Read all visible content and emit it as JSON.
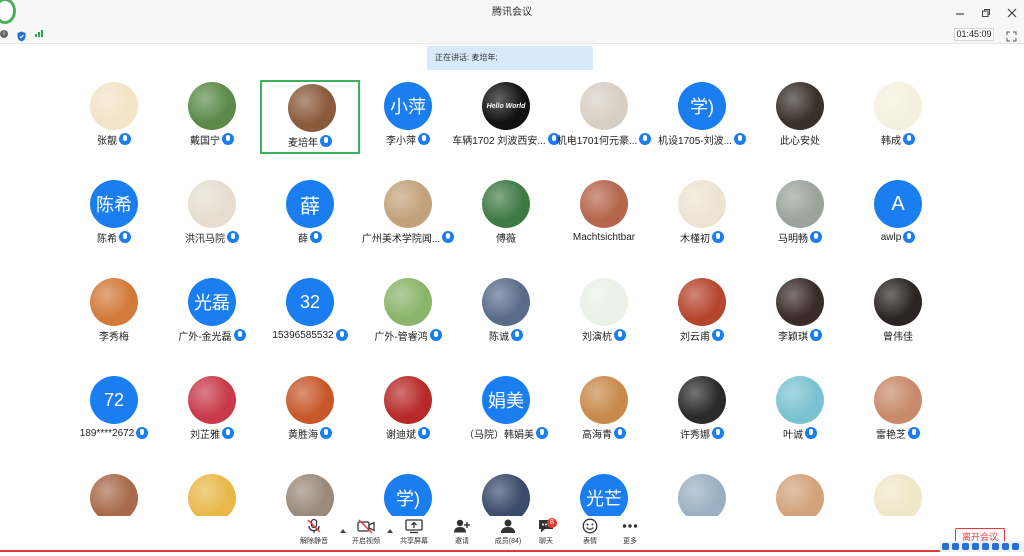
{
  "window": {
    "title": "腾讯会议"
  },
  "toolbar": {
    "timer": "01:45:09"
  },
  "speaker": {
    "banner": "正在讲话: 麦培年;"
  },
  "participants": [
    {
      "name": "张靓",
      "avatar": {
        "kind": "image",
        "label": "cartoon-girl",
        "bg": "#f3e3c8"
      },
      "mic": "on"
    },
    {
      "name": "戴国宁",
      "avatar": {
        "kind": "image",
        "label": "park-photo",
        "bg": "#5c8a4a"
      },
      "mic": "on",
      "host": true
    },
    {
      "name": "麦培年",
      "avatar": {
        "kind": "image",
        "label": "calligraphy",
        "bg": "#8a5a3a"
      },
      "mic": "speaking",
      "selected": true
    },
    {
      "name": "李小萍",
      "avatar": {
        "kind": "text",
        "text": "小萍"
      },
      "mic": "on"
    },
    {
      "name": "车辆1702 刘波西安...",
      "avatar": {
        "kind": "image",
        "label": "Hello World",
        "bg": "#111111"
      },
      "mic": "on"
    },
    {
      "name": "机电1701何元豪...",
      "avatar": {
        "kind": "image",
        "label": "cat-photo",
        "bg": "#d8cfc4"
      },
      "mic": "on"
    },
    {
      "name": "机设1705-刘波...",
      "avatar": {
        "kind": "text",
        "text": "学)"
      },
      "mic": "on"
    },
    {
      "name": "此心安处",
      "avatar": {
        "kind": "image",
        "label": "piano-photo",
        "bg": "#3a302a"
      },
      "mic": "none"
    },
    {
      "name": "韩成",
      "avatar": {
        "kind": "image",
        "label": "sunflower",
        "bg": "#f4f0dd"
      },
      "mic": "on"
    },
    {
      "name": "陈希",
      "avatar": {
        "kind": "text",
        "text": "陈希"
      },
      "mic": "on"
    },
    {
      "name": "洪汛马院",
      "avatar": {
        "kind": "image",
        "label": "drawing",
        "bg": "#e6ddd0"
      },
      "mic": "on"
    },
    {
      "name": "薛",
      "avatar": {
        "kind": "text",
        "text": "薛"
      },
      "mic": "on"
    },
    {
      "name": "广州美术学院闻...",
      "avatar": {
        "kind": "image",
        "label": "anime",
        "bg": "#c2a27a"
      },
      "mic": "on"
    },
    {
      "name": "傅薇",
      "avatar": {
        "kind": "image",
        "label": "leaves",
        "bg": "#3f7a45"
      },
      "mic": "none"
    },
    {
      "name": "Machtsichtbar",
      "avatar": {
        "kind": "image",
        "label": "friends-photo",
        "bg": "#b5654a"
      },
      "mic": "none"
    },
    {
      "name": "木槿初",
      "avatar": {
        "kind": "image",
        "label": "anime-girl",
        "bg": "#ede3d2"
      },
      "mic": "on"
    },
    {
      "name": "马明畅",
      "avatar": {
        "kind": "image",
        "label": "mountain",
        "bg": "#9aa49c"
      },
      "mic": "on"
    },
    {
      "name": "awlp",
      "avatar": {
        "kind": "text",
        "text": "A"
      },
      "mic": "on"
    },
    {
      "name": "李秀梅",
      "avatar": {
        "kind": "image",
        "label": "sunset-mountain",
        "bg": "#d27a3a"
      },
      "mic": "none"
    },
    {
      "name": "广外-金光磊",
      "avatar": {
        "kind": "text",
        "text": "光磊"
      },
      "mic": "on"
    },
    {
      "name": "15396585532",
      "avatar": {
        "kind": "text",
        "text": "32"
      },
      "mic": "on"
    },
    {
      "name": "广外-管睿鸿",
      "avatar": {
        "kind": "image",
        "label": "boy-photo",
        "bg": "#8ab46a"
      },
      "mic": "on"
    },
    {
      "name": "陈诚",
      "avatar": {
        "kind": "image",
        "label": "sky-photo",
        "bg": "#5a6b8a"
      },
      "mic": "on"
    },
    {
      "name": "刘演杭",
      "avatar": {
        "kind": "image",
        "label": "cartoon-bear",
        "bg": "#eaf1e6"
      },
      "mic": "on"
    },
    {
      "name": "刘云甫",
      "avatar": {
        "kind": "image",
        "label": "food-photo",
        "bg": "#b5462e"
      },
      "mic": "on"
    },
    {
      "name": "李颖琪",
      "avatar": {
        "kind": "image",
        "label": "rabbit",
        "bg": "#3a2a2a"
      },
      "mic": "on"
    },
    {
      "name": "曾伟佳",
      "avatar": {
        "kind": "image",
        "label": "portrait",
        "bg": "#2a2422"
      },
      "mic": "none"
    },
    {
      "name": "189****2672",
      "avatar": {
        "kind": "text",
        "text": "72"
      },
      "mic": "on"
    },
    {
      "name": "刘芷雅",
      "avatar": {
        "kind": "image",
        "label": "flowers",
        "bg": "#c83a4a"
      },
      "mic": "on"
    },
    {
      "name": "黄胜海",
      "avatar": {
        "kind": "image",
        "label": "sunset",
        "bg": "#c8582a"
      },
      "mic": "on"
    },
    {
      "name": "谢迪斌",
      "avatar": {
        "kind": "image",
        "label": "red-flower",
        "bg": "#b82a2a"
      },
      "mic": "on"
    },
    {
      "name": "（马院）韩娟美",
      "avatar": {
        "kind": "text",
        "text": "娟美"
      },
      "mic": "on"
    },
    {
      "name": "高海青",
      "avatar": {
        "kind": "image",
        "label": "tiger",
        "bg": "#c88a4a"
      },
      "mic": "on"
    },
    {
      "name": "许秀娜",
      "avatar": {
        "kind": "image",
        "label": "dark-art",
        "bg": "#2a2a2a"
      },
      "mic": "on"
    },
    {
      "name": "叶诚",
      "avatar": {
        "kind": "image",
        "label": "sea",
        "bg": "#7ac2d0"
      },
      "mic": "on"
    },
    {
      "name": "雷艳芝",
      "avatar": {
        "kind": "image",
        "label": "girl-photo",
        "bg": "#c88a6a"
      },
      "mic": "speaking"
    },
    {
      "name": "",
      "avatar": {
        "kind": "image",
        "label": "silhouette",
        "bg": "#a86a4a"
      },
      "mic": "none"
    },
    {
      "name": "",
      "avatar": {
        "kind": "image",
        "label": "cartoon",
        "bg": "#e8b84a"
      },
      "mic": "none"
    },
    {
      "name": "",
      "avatar": {
        "kind": "image",
        "label": "mother-child",
        "bg": "#9a8a7a"
      },
      "mic": "none"
    },
    {
      "name": "",
      "avatar": {
        "kind": "text",
        "text": "学)"
      },
      "mic": "none"
    },
    {
      "name": "",
      "avatar": {
        "kind": "image",
        "label": "man-photo",
        "bg": "#3a4a6a"
      },
      "mic": "none"
    },
    {
      "name": "",
      "avatar": {
        "kind": "text",
        "text": "光芒"
      },
      "mic": "none"
    },
    {
      "name": "",
      "avatar": {
        "kind": "image",
        "label": "beach",
        "bg": "#9ab0c2"
      },
      "mic": "none"
    },
    {
      "name": "",
      "avatar": {
        "kind": "image",
        "label": "selfie",
        "bg": "#d2a27a"
      },
      "mic": "none"
    },
    {
      "name": "",
      "avatar": {
        "kind": "image",
        "label": "cartoon-dog",
        "bg": "#f0e6c8"
      },
      "mic": "none"
    }
  ],
  "controls": [
    {
      "label": "解除静音",
      "icon": "mic-muted-icon"
    },
    {
      "label": "开启视频",
      "icon": "camera-off-icon"
    },
    {
      "label": "共享屏幕",
      "icon": "share-screen-icon"
    },
    {
      "label": "邀请",
      "icon": "invite-icon"
    },
    {
      "label": "成员(84)",
      "icon": "members-icon"
    },
    {
      "label": "聊天",
      "icon": "chat-icon",
      "badge": "8"
    },
    {
      "label": "表情",
      "icon": "emoji-icon"
    },
    {
      "label": "更多",
      "icon": "more-icon"
    }
  ],
  "end_button": "离开会议",
  "colors": {
    "accent": "#1a7ef0",
    "end": "#e03a3a",
    "speaking": "#3cb35a"
  }
}
